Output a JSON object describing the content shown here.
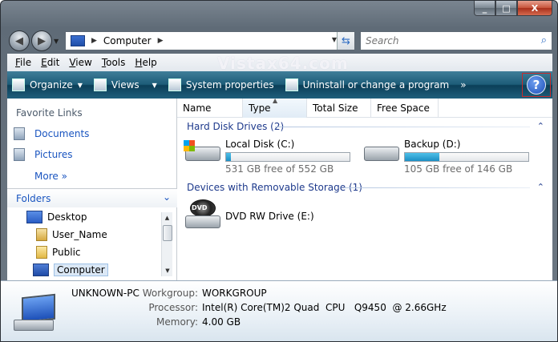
{
  "window": {
    "caption_buttons": {
      "minimize": "_",
      "maximize": "□",
      "close": "X"
    }
  },
  "address": {
    "path": "Computer",
    "search_placeholder": "Search"
  },
  "watermark": "Vistax64.com",
  "menu": [
    {
      "accel": "F",
      "rest": "ile"
    },
    {
      "accel": "E",
      "rest": "dit"
    },
    {
      "accel": "V",
      "rest": "iew"
    },
    {
      "accel": "T",
      "rest": "ools"
    },
    {
      "accel": "H",
      "rest": "elp"
    }
  ],
  "commandbar": {
    "organize": "Organize",
    "views": "Views",
    "system_properties": "System properties",
    "uninstall": "Uninstall or change a program",
    "more": "»",
    "help": "?"
  },
  "navpane": {
    "favorites_title": "Favorite Links",
    "favorites": [
      "Documents",
      "Pictures"
    ],
    "more": "More  »",
    "folders_title": "Folders",
    "tree": [
      "Desktop",
      "User_Name",
      "Public",
      "Computer"
    ]
  },
  "columns": [
    "Name",
    "Type",
    "Total Size",
    "Free Space"
  ],
  "groups": {
    "hdd": "Hard Disk Drives (2)",
    "removable": "Devices with Removable Storage (1)"
  },
  "drives": [
    {
      "name": "Local Disk (C:)",
      "free_text": "531 GB free of 552 GB",
      "used_fraction": 0.04
    },
    {
      "name": "Backup (D:)",
      "free_text": "105 GB free of 146 GB",
      "used_fraction": 0.28
    }
  ],
  "dvd": {
    "name": "DVD RW Drive (E:)",
    "icon_text": "DVD"
  },
  "details": {
    "pc_name": "UNKNOWN-PC",
    "workgroup_label": "Workgroup:",
    "workgroup": "WORKGROUP",
    "processor_label": "Processor:",
    "processor": "Intel(R) Core(TM)2 Quad  CPU   Q9450  @ 2.66GHz",
    "memory_label": "Memory:",
    "memory": "4.00 GB"
  }
}
